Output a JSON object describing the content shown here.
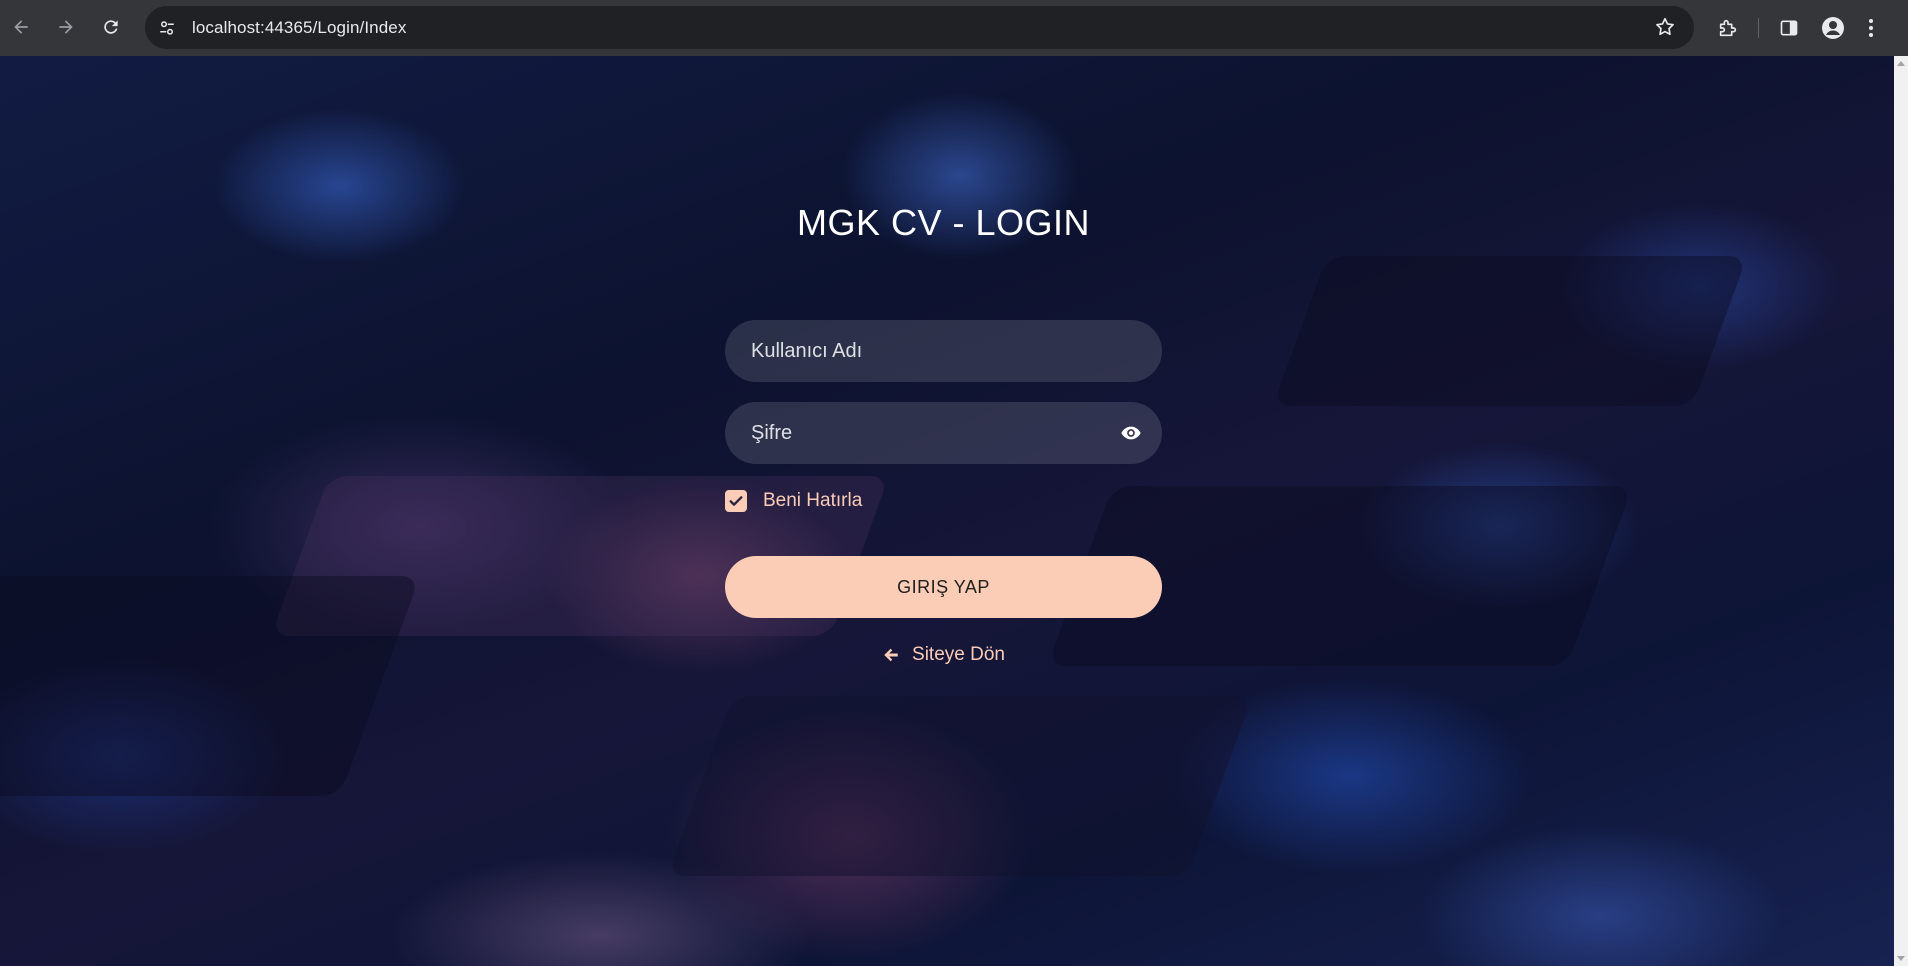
{
  "browser": {
    "url": "localhost:44365/Login/Index"
  },
  "login": {
    "title": "MGK CV - LOGIN",
    "username_placeholder": "Kullanıcı Adı",
    "password_placeholder": "Şifre",
    "remember_label": "Beni Hatırla",
    "remember_checked": true,
    "submit_label": "GIRIŞ YAP",
    "back_link_label": "Siteye Dön"
  },
  "colors": {
    "accent": "#fbcdb7",
    "chrome_bg": "#35363a",
    "omnibox_bg": "#202124"
  },
  "icons": {
    "back": "arrow-left-icon",
    "forward": "arrow-right-icon",
    "reload": "reload-icon",
    "site_info": "tune-icon",
    "bookmark": "star-icon",
    "extensions": "puzzle-icon",
    "side_panel": "side-panel-icon",
    "profile": "person-icon",
    "menu": "kebab-menu-icon",
    "password_toggle": "eye-icon",
    "remember_check": "check-icon",
    "back_link": "arrow-left-icon"
  }
}
